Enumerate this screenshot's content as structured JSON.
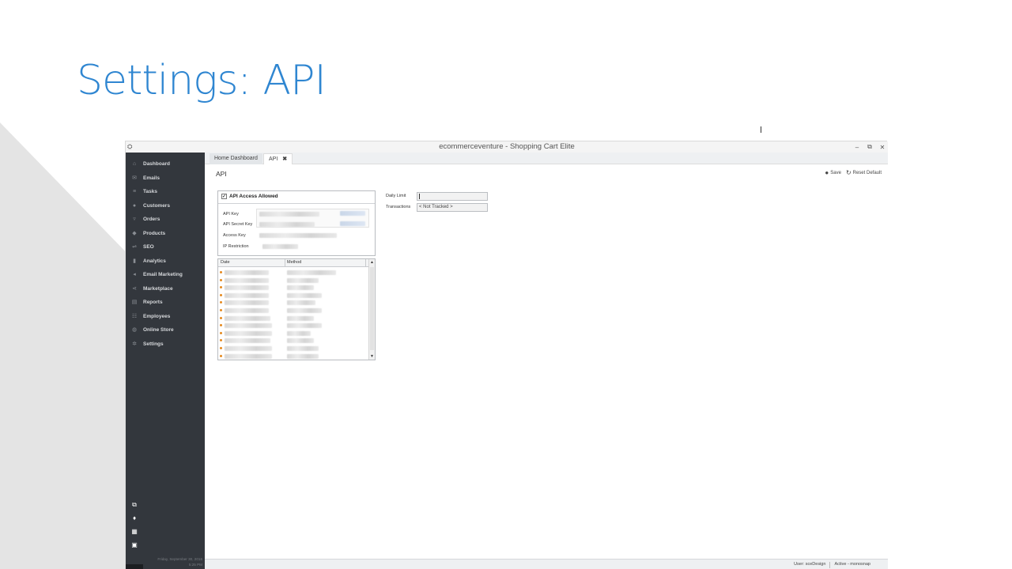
{
  "slide": {
    "title": "Settings: API"
  },
  "window": {
    "title": "ecommerceventure - Shopping Cart Elite",
    "controls": [
      "–",
      "⧉",
      "✕"
    ]
  },
  "sidebar": {
    "items": [
      {
        "label": "Dashboard",
        "icon": "home-icon"
      },
      {
        "label": "Emails",
        "icon": "mail-icon"
      },
      {
        "label": "Tasks",
        "icon": "tasks-icon"
      },
      {
        "label": "Customers",
        "icon": "person-icon"
      },
      {
        "label": "Orders",
        "icon": "cart-icon"
      },
      {
        "label": "Products",
        "icon": "tag-icon"
      },
      {
        "label": "SEO",
        "icon": "sliders-icon"
      },
      {
        "label": "Analytics",
        "icon": "bar-chart-icon"
      },
      {
        "label": "Email Marketing",
        "icon": "megaphone-icon"
      },
      {
        "label": "Marketplace",
        "icon": "share-icon"
      },
      {
        "label": "Reports",
        "icon": "report-icon"
      },
      {
        "label": "Employees",
        "icon": "people-icon"
      },
      {
        "label": "Online Store",
        "icon": "globe-icon"
      },
      {
        "label": "Settings",
        "icon": "gear-icon"
      }
    ],
    "datetime_line1": "Friday, September 30, 2016",
    "datetime_line2": "5:25 PM",
    "more_label": "•••"
  },
  "tabs": {
    "home": "Home Dashboard",
    "api": "API",
    "close": "✖"
  },
  "page": {
    "heading": "API"
  },
  "toolbar": {
    "save": "Save",
    "reset": "Reset Default"
  },
  "api_panel": {
    "access_label": "API Access Allowed",
    "checked_mark": "✓",
    "fields": {
      "api_key": "API Key",
      "api_secret_key": "API Secret Key",
      "access_key": "Access Key",
      "ip_restriction": "IP Restriction"
    }
  },
  "limits": {
    "daily_limit_label": "Daily Limit",
    "daily_limit_value": "",
    "transactions_label": "Transactions",
    "transactions_value": "< Not Tracked >"
  },
  "log_table": {
    "columns": [
      "Date",
      "Method"
    ],
    "scroll_up": "▲",
    "scroll_down": "▼"
  },
  "statusbar": {
    "user": "User: sceDesign",
    "state": "Active - monosnap"
  },
  "colors": {
    "title_blue": "#2f86d1",
    "sidebar_bg": "#33373d",
    "row_dot": "#e58a1f",
    "decor_triangle": "#e4e4e4"
  }
}
